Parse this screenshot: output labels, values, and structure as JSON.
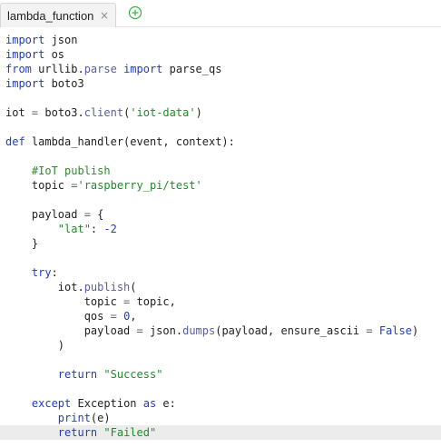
{
  "tab": {
    "title": "lambda_function",
    "close_glyph": "×",
    "new_tab_icon": "plus-circle-icon"
  },
  "code": {
    "active_line_index": 27,
    "lines": [
      [
        [
          "kw",
          "import"
        ],
        [
          "plain",
          " json"
        ]
      ],
      [
        [
          "kw",
          "import"
        ],
        [
          "plain",
          " os"
        ]
      ],
      [
        [
          "kw",
          "from"
        ],
        [
          "plain",
          " urllib."
        ],
        [
          "fn",
          "parse"
        ],
        [
          "plain",
          " "
        ],
        [
          "kw",
          "import"
        ],
        [
          "plain",
          " parse_qs"
        ]
      ],
      [
        [
          "kw",
          "import"
        ],
        [
          "plain",
          " boto3"
        ]
      ],
      [],
      [
        [
          "plain",
          "iot "
        ],
        [
          "op",
          "="
        ],
        [
          "plain",
          " boto3."
        ],
        [
          "fn",
          "client"
        ],
        [
          "plain",
          "("
        ],
        [
          "str",
          "'iot-data'"
        ],
        [
          "plain",
          ")"
        ]
      ],
      [],
      [
        [
          "kw",
          "def"
        ],
        [
          "plain",
          " lambda_handler(event, context):"
        ]
      ],
      [],
      [
        [
          "plain",
          "    "
        ],
        [
          "com",
          "#IoT publish"
        ]
      ],
      [
        [
          "plain",
          "    topic "
        ],
        [
          "op",
          "="
        ],
        [
          "str",
          "'raspberry_pi/test'"
        ]
      ],
      [],
      [
        [
          "plain",
          "    payload "
        ],
        [
          "op",
          "="
        ],
        [
          "plain",
          " {"
        ]
      ],
      [
        [
          "plain",
          "        "
        ],
        [
          "str",
          "\"lat\""
        ],
        [
          "plain",
          ": "
        ],
        [
          "num",
          "-2"
        ]
      ],
      [
        [
          "plain",
          "    }"
        ]
      ],
      [],
      [
        [
          "plain",
          "    "
        ],
        [
          "kw",
          "try"
        ],
        [
          "plain",
          ":"
        ]
      ],
      [
        [
          "plain",
          "        iot."
        ],
        [
          "fn",
          "publish"
        ],
        [
          "plain",
          "("
        ]
      ],
      [
        [
          "plain",
          "            topic "
        ],
        [
          "op",
          "="
        ],
        [
          "plain",
          " topic,"
        ]
      ],
      [
        [
          "plain",
          "            qos "
        ],
        [
          "op",
          "="
        ],
        [
          "plain",
          " "
        ],
        [
          "num",
          "0"
        ],
        [
          "plain",
          ","
        ]
      ],
      [
        [
          "plain",
          "            payload "
        ],
        [
          "op",
          "="
        ],
        [
          "plain",
          " json."
        ],
        [
          "fn",
          "dumps"
        ],
        [
          "plain",
          "(payload, ensure_ascii "
        ],
        [
          "op",
          "="
        ],
        [
          "plain",
          " "
        ],
        [
          "kw",
          "False"
        ],
        [
          "plain",
          ")"
        ]
      ],
      [
        [
          "plain",
          "        )"
        ]
      ],
      [],
      [
        [
          "plain",
          "        "
        ],
        [
          "kw",
          "return"
        ],
        [
          "plain",
          " "
        ],
        [
          "str",
          "\"Success\""
        ]
      ],
      [],
      [
        [
          "plain",
          "    "
        ],
        [
          "kw",
          "except"
        ],
        [
          "plain",
          " Exception "
        ],
        [
          "kw",
          "as"
        ],
        [
          "plain",
          " e:"
        ]
      ],
      [
        [
          "plain",
          "        "
        ],
        [
          "kw",
          "print"
        ],
        [
          "plain",
          "(e)"
        ]
      ],
      [
        [
          "plain",
          "        "
        ],
        [
          "kw",
          "return"
        ],
        [
          "plain",
          " "
        ],
        [
          "str",
          "\"Failed\""
        ]
      ]
    ]
  }
}
